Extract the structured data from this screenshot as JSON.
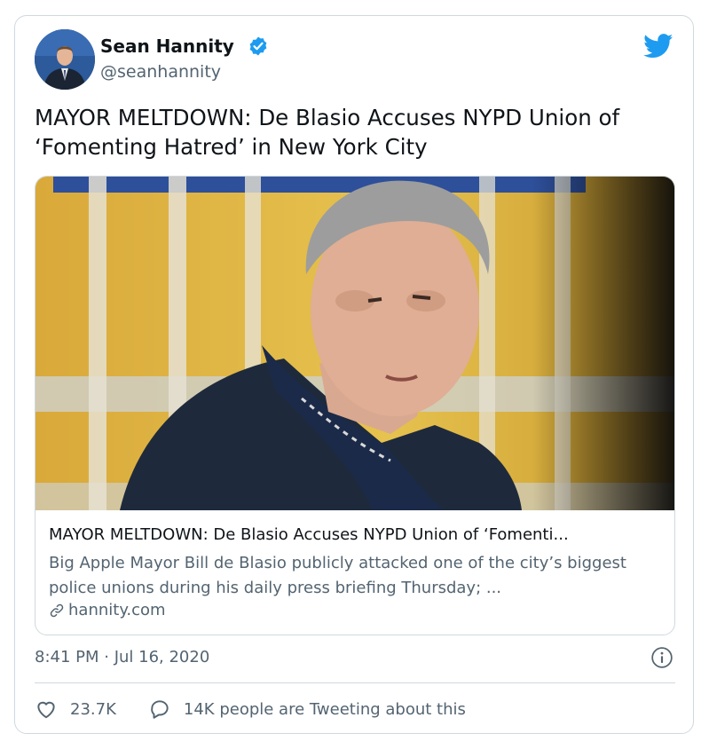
{
  "author": {
    "name": "Sean Hannity",
    "handle": "@seanhannity"
  },
  "tweet": {
    "text": "MAYOR MELTDOWN: De Blasio Accuses NYPD Union of ‘Fomenting Hatred’ in New York City"
  },
  "card": {
    "title": "MAYOR MELTDOWN: De Blasio Accuses NYPD Union of ‘Fomenti...",
    "description": "Big Apple Mayor Bill de Blasio publicly attacked one of the city’s biggest police unions during his daily press briefing Thursday; ...",
    "domain": "hannity.com"
  },
  "meta": {
    "timestamp": "8:41 PM · Jul 16, 2020"
  },
  "actions": {
    "likes": "23.7K",
    "reply_text": "14K people are Tweeting about this"
  },
  "icons": {
    "verified": "verified-badge-icon",
    "twitter": "twitter-bird-icon",
    "link": "link-icon",
    "info": "info-icon",
    "like": "heart-icon",
    "reply": "speech-bubble-icon"
  },
  "colors": {
    "twitter_blue": "#1d9bf0",
    "text_primary": "#0f1419",
    "text_secondary": "#536471",
    "border": "#cfd9de"
  }
}
